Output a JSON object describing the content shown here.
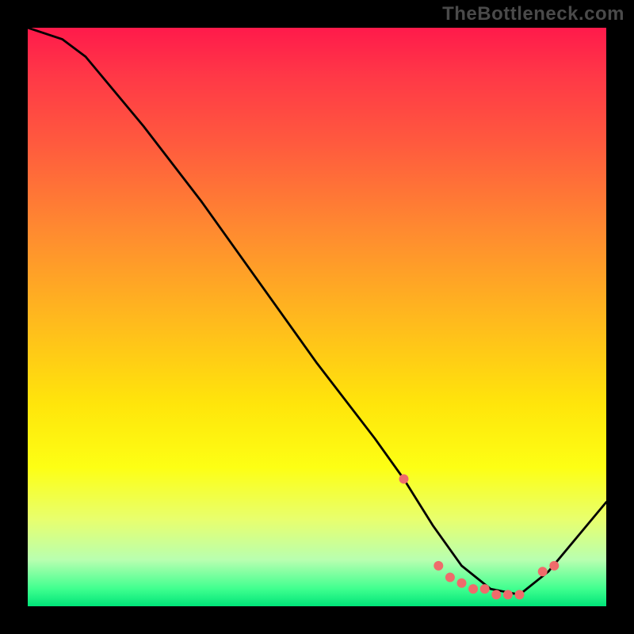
{
  "watermark": "TheBottleneck.com",
  "chart_data": {
    "type": "line",
    "title": "",
    "xlabel": "",
    "ylabel": "",
    "xlim": [
      0,
      100
    ],
    "ylim": [
      0,
      100
    ],
    "series": [
      {
        "name": "curve",
        "x": [
          0,
          6,
          10,
          20,
          30,
          40,
          50,
          60,
          65,
          70,
          75,
          80,
          85,
          90,
          100
        ],
        "values": [
          100,
          98,
          95,
          83,
          70,
          56,
          42,
          29,
          22,
          14,
          7,
          3,
          2,
          6,
          18
        ]
      }
    ],
    "markers": {
      "name": "dots",
      "x": [
        65,
        71,
        73,
        75,
        77,
        79,
        81,
        83,
        85,
        89,
        91
      ],
      "values": [
        22,
        7,
        5,
        4,
        3,
        3,
        2,
        2,
        2,
        6,
        7
      ]
    },
    "gradient_stops": [
      {
        "pct": 0,
        "color": "#ff1a4b"
      },
      {
        "pct": 8,
        "color": "#ff3747"
      },
      {
        "pct": 20,
        "color": "#ff5a3e"
      },
      {
        "pct": 35,
        "color": "#ff8a30"
      },
      {
        "pct": 50,
        "color": "#ffb81e"
      },
      {
        "pct": 65,
        "color": "#ffe50b"
      },
      {
        "pct": 76,
        "color": "#fdff14"
      },
      {
        "pct": 85,
        "color": "#e8ff6e"
      },
      {
        "pct": 92,
        "color": "#b8ffb0"
      },
      {
        "pct": 97,
        "color": "#3fff8f"
      },
      {
        "pct": 100,
        "color": "#00e479"
      }
    ]
  }
}
